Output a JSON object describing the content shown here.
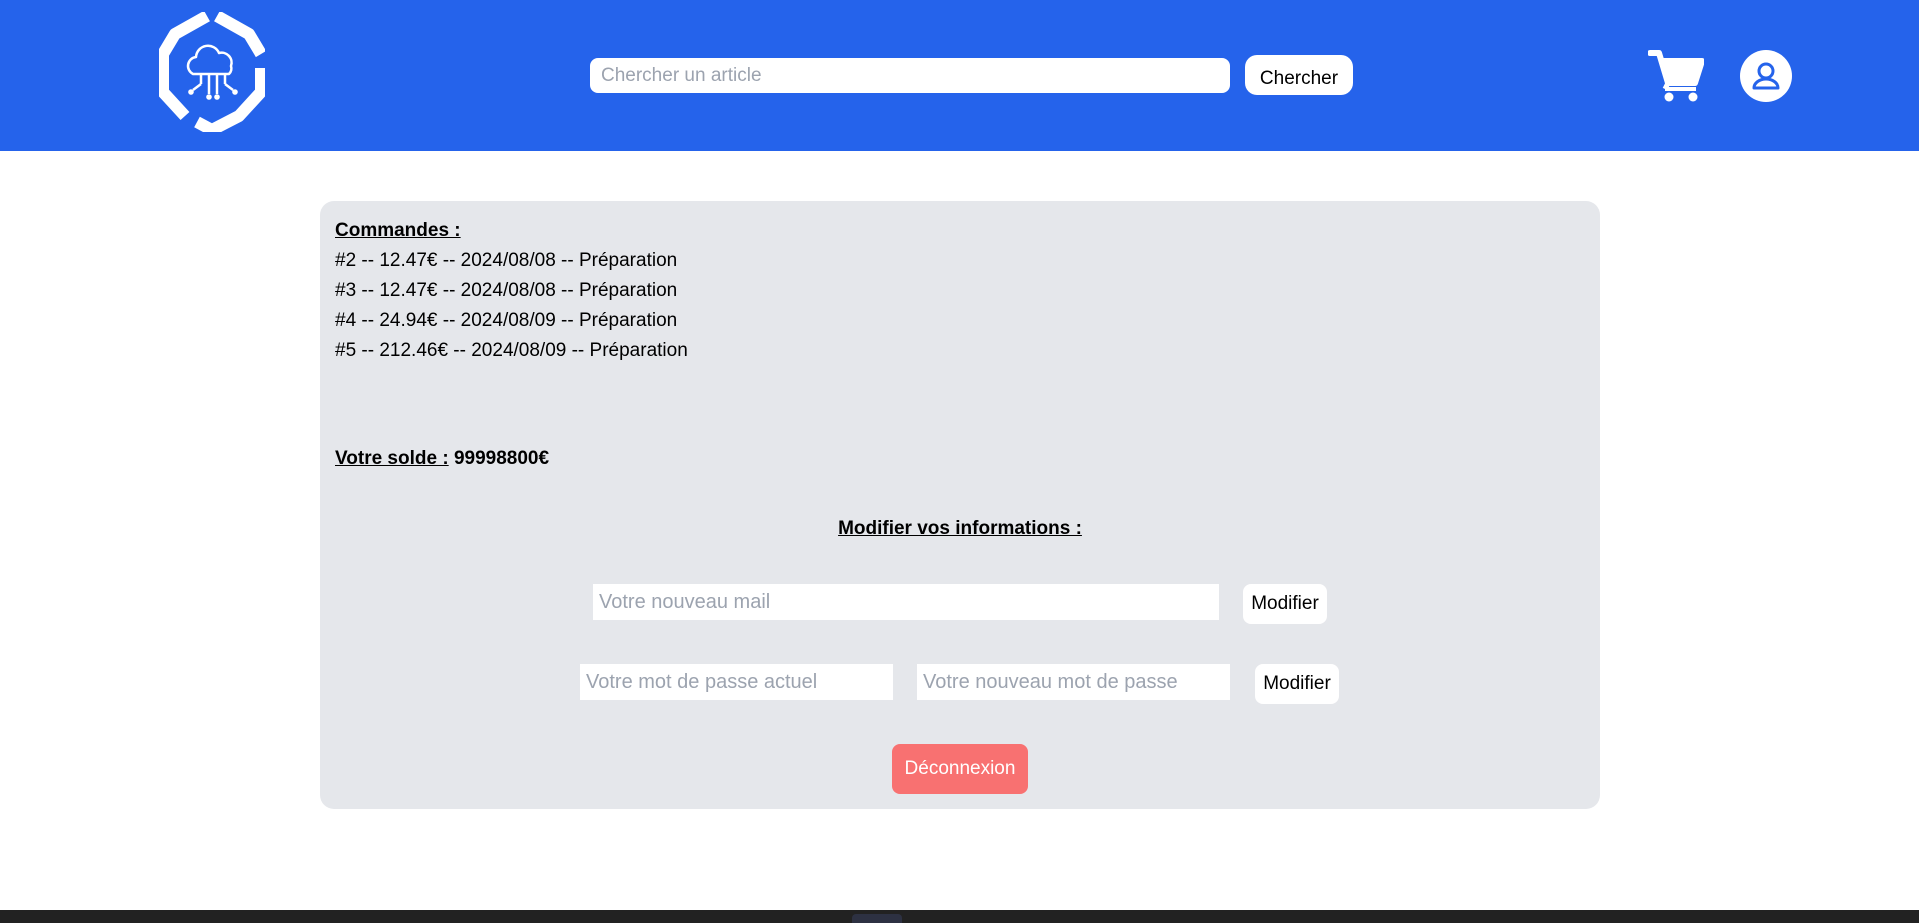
{
  "header": {
    "search_placeholder": "Chercher un article",
    "search_button": "Chercher",
    "brand_color": "#2563eb",
    "logo_icon": "cloud-hexagon-logo",
    "cart_icon": "shopping-cart-icon",
    "user_icon": "user-icon"
  },
  "orders": {
    "heading": "Commandes :",
    "items": [
      "#2 -- 12.47€ -- 2024/08/08 -- Préparation",
      "#3 -- 12.47€ -- 2024/08/08 -- Préparation",
      "#4 -- 24.94€ -- 2024/08/09 -- Préparation",
      "#5 -- 212.46€ -- 2024/08/09 -- Préparation"
    ]
  },
  "balance": {
    "label": "Votre solde :",
    "value": "99998800€"
  },
  "modify": {
    "title": "Modifier vos informations :",
    "email_placeholder": "Votre nouveau mail",
    "email_button": "Modifier",
    "current_password_placeholder": "Votre mot de passe actuel",
    "new_password_placeholder": "Votre nouveau mot de passe",
    "password_button": "Modifier"
  },
  "logout": {
    "label": "Déconnexion",
    "color": "#f87171"
  },
  "panel_color": "#e5e7eb"
}
